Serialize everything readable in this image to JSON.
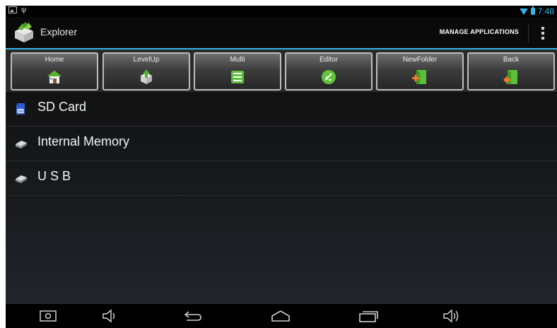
{
  "status_bar": {
    "time": "7:48",
    "icons": [
      "photo-icon",
      "usb-icon",
      "wifi-icon",
      "battery-icon"
    ],
    "accent_color": "#33b5e5"
  },
  "action_bar": {
    "title": "Explorer",
    "app_icon": "explorer-app-icon",
    "action": "MANAGE APPLICATIONS",
    "overflow_icon": "overflow-menu-icon"
  },
  "toolbar": {
    "buttons": [
      {
        "label": "Home",
        "icon": "home-icon"
      },
      {
        "label": "LevelUp",
        "icon": "level-up-icon"
      },
      {
        "label": "Multi",
        "icon": "multi-select-icon"
      },
      {
        "label": "Editor",
        "icon": "editor-icon"
      },
      {
        "label": "NewFolder",
        "icon": "new-folder-icon"
      },
      {
        "label": "Back",
        "icon": "back-icon"
      }
    ]
  },
  "file_list": {
    "items": [
      {
        "label": "SD Card",
        "icon": "sd-card-icon"
      },
      {
        "label": "Internal Memory",
        "icon": "drive-icon"
      },
      {
        "label": "U S B",
        "icon": "drive-icon"
      }
    ]
  },
  "nav_bar": {
    "buttons": [
      "screenshot-icon",
      "volume-down-icon",
      "back-nav-icon",
      "home-nav-icon",
      "recents-icon",
      "volume-up-icon"
    ]
  }
}
